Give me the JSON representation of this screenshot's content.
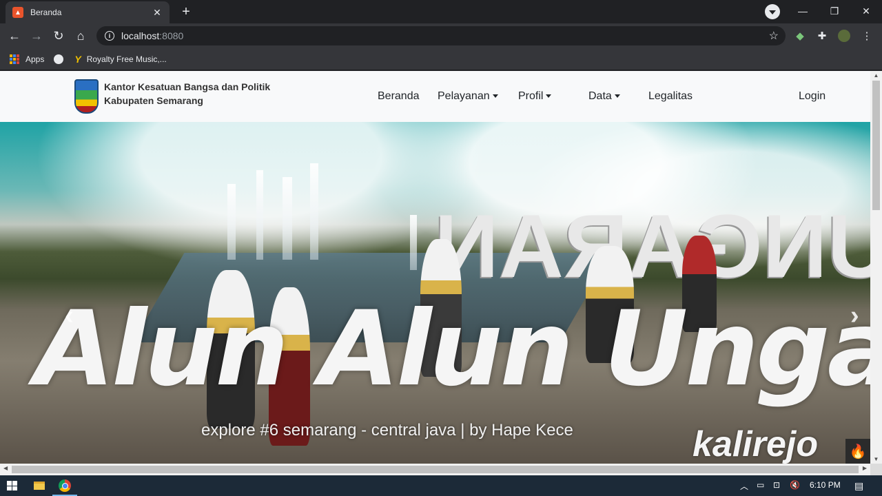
{
  "browser": {
    "tab_title": "Beranda",
    "tab_close": "✕",
    "new_tab": "+",
    "url_host": "localhost",
    "url_port": ":8080",
    "window_min": "—",
    "window_restore": "❐",
    "window_close": "✕",
    "bookmarks": [
      {
        "label": "Apps"
      },
      {
        "label": ""
      },
      {
        "label": "Royalty Free Music,..."
      }
    ]
  },
  "site": {
    "brand_line1": "Kantor Kesatuan Bangsa dan Politik",
    "brand_line2": "Kabupaten Semarang",
    "menu": {
      "beranda": "Beranda",
      "pelayanan": "Pelayanan",
      "profil": "Profil",
      "data": "Data",
      "legalitas": "Legalitas",
      "login": "Login"
    },
    "hero": {
      "script_title": "Alun Alun Ungaran",
      "subtitle": "explore #6 semarang - central java | by Hape Kece",
      "kalirejo": "kalirejo",
      "letters": "UNGARAN",
      "prev": "‹",
      "next": "›"
    }
  },
  "taskbar": {
    "time": "6:10 PM"
  },
  "colors": {
    "browser_bg": "#202124",
    "toolbar_bg": "#35363a",
    "page_bg": "#f8f9fa",
    "taskbar_bg": "#1c2a38"
  }
}
